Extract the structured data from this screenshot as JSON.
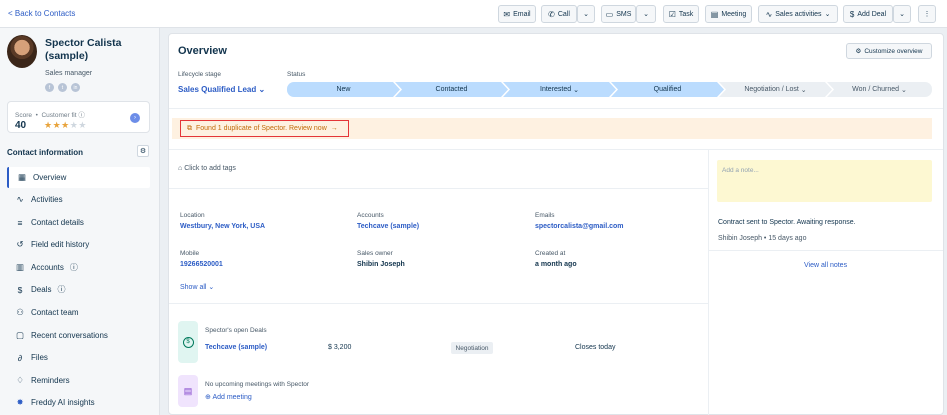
{
  "topbar": {
    "back_label": "< Back to Contacts",
    "buttons": {
      "email": "Email",
      "call": "Call",
      "sms": "SMS",
      "task": "Task",
      "meeting": "Meeting",
      "sales_activities": "Sales activities",
      "add_deal": "Add Deal"
    }
  },
  "contact": {
    "name_line1": "Spector Calista",
    "name_line2": "(sample)",
    "title": "Sales manager",
    "score_label": "Score",
    "fit_label": "Customer fit",
    "score": "40",
    "fit_stars": 3,
    "fit_max": 5
  },
  "sidebar": {
    "section_title": "Contact information",
    "items": [
      {
        "label": "Overview"
      },
      {
        "label": "Activities"
      },
      {
        "label": "Contact details"
      },
      {
        "label": "Field edit history"
      },
      {
        "label": "Accounts"
      },
      {
        "label": "Deals"
      },
      {
        "label": "Contact team"
      },
      {
        "label": "Recent conversations"
      },
      {
        "label": "Files"
      },
      {
        "label": "Reminders"
      },
      {
        "label": "Freddy AI insights"
      }
    ]
  },
  "overview": {
    "title": "Overview",
    "customize_label": "Customize overview",
    "lifecycle_label": "Lifecycle stage",
    "lifecycle_value": "Sales Qualified Lead",
    "status_label": "Status",
    "stages": [
      "New",
      "Contacted",
      "Interested",
      "Qualified",
      "Negotiation / Lost",
      "Won / Churned"
    ],
    "duplicate_msg": "Found 1 duplicate of Spector. Review now",
    "tags_placeholder": "Click to add tags",
    "fields": {
      "location_label": "Location",
      "location_value": "Westbury, New York, USA",
      "accounts_label": "Accounts",
      "accounts_value": "Techcave (sample)",
      "emails_label": "Emails",
      "emails_value": "spectorcalista@gmail.com",
      "mobile_label": "Mobile",
      "mobile_value": "19266520001",
      "owner_label": "Sales owner",
      "owner_value": "Shibin Joseph",
      "created_label": "Created at",
      "created_value": "a month ago"
    },
    "show_all": "Show all",
    "deals": {
      "heading": "Spector's open Deals",
      "deal_name": "Techcave (sample)",
      "amount": "$ 3,200",
      "stage": "Negotiation",
      "closes": "Closes today"
    },
    "meetings": {
      "empty_text": "No upcoming meetings with Spector",
      "add_label": "Add meeting"
    }
  },
  "notes": {
    "placeholder": "Add a note...",
    "latest_text": "Contract sent to Spector. Awaiting response.",
    "author": "Shibin Joseph",
    "time": "15 days ago",
    "view_all": "View all notes"
  }
}
